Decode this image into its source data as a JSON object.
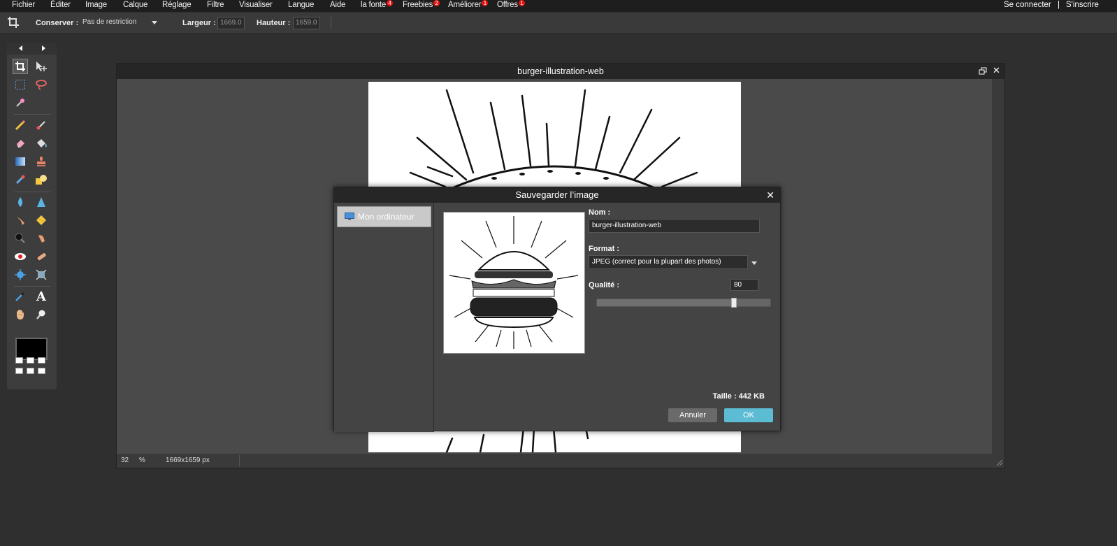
{
  "menu": {
    "items": [
      {
        "label": "Fichier"
      },
      {
        "label": "Éditer"
      },
      {
        "label": "Image"
      },
      {
        "label": "Calque"
      },
      {
        "label": "Réglage"
      },
      {
        "label": "Filtre"
      },
      {
        "label": "Visualiser"
      },
      {
        "label": "Langue"
      },
      {
        "label": "Aide"
      },
      {
        "label": "la fonte",
        "badge": "4"
      },
      {
        "label": "Freebies",
        "badge": "2"
      },
      {
        "label": "Améliorer",
        "badge": "1"
      },
      {
        "label": "Offres",
        "badge": "1"
      }
    ],
    "login": "Se connecter",
    "separator": "|",
    "register": "S'inscrire"
  },
  "options": {
    "keep_label": "Conserver :",
    "keep_value": "Pas de restriction",
    "width_label": "Largeur :",
    "width_value": "1669.0",
    "height_label": "Hauteur :",
    "height_value": "1659.0"
  },
  "image_window": {
    "title": "burger-illustration-web",
    "zoom": "32",
    "zoom_unit": "%",
    "dimensions": "1669x1659 px"
  },
  "dialog": {
    "title": "Sauvegarder l’image",
    "side_item": "Mon ordinateur",
    "name_label": "Nom :",
    "name_value": "burger-illustration-web",
    "format_label": "Format :",
    "format_value": "JPEG (correct pour la plupart des photos)",
    "quality_label": "Qualité :",
    "quality_value": "80",
    "quality_fraction": 0.8,
    "size_text": "Taille : 442 KB",
    "cancel": "Annuler",
    "ok": "OK"
  },
  "colors": {
    "accent": "#5bbcd4",
    "badge": "#ee1111",
    "foreground_color": "#000000"
  }
}
